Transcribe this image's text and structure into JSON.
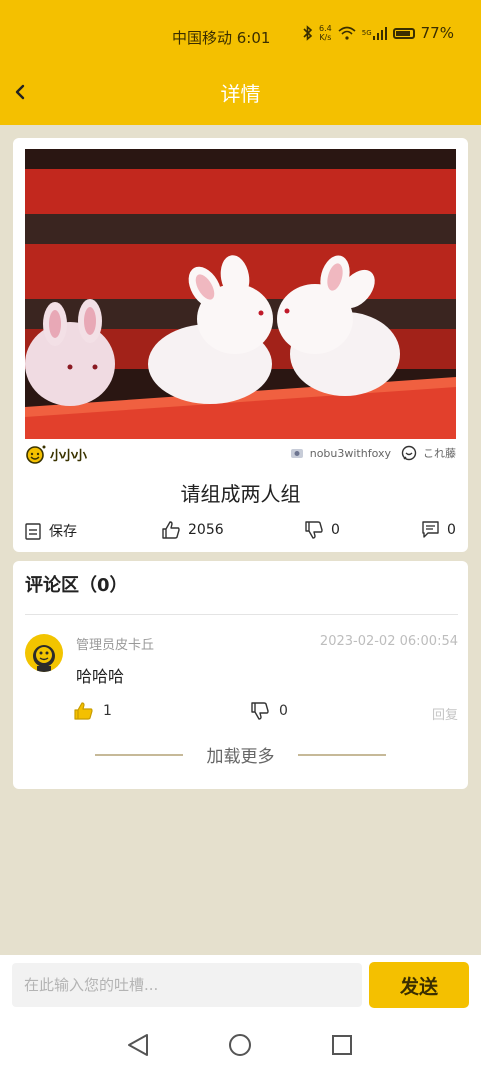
{
  "status_bar": {
    "carrier_time": "中国移动 6:01",
    "net_speed_top": "6.4",
    "net_speed_bottom": "K/s",
    "signal_label": "5G",
    "battery": "77%"
  },
  "header": {
    "title": "详情"
  },
  "post": {
    "credit_left": "小小小",
    "photographer": "nobu3withfoxy",
    "source": "これ藤",
    "title": "请组成两人组",
    "save_label": "保存",
    "like_count": "2056",
    "dislike_count": "0",
    "comment_count": "0"
  },
  "comments_section": {
    "title": "评论区（0）",
    "comments": [
      {
        "author": "管理员皮卡丘",
        "time": "2023-02-02 06:00:54",
        "text": "哈哈哈",
        "likes": "1",
        "dislikes": "0",
        "reply_label": "回复"
      }
    ],
    "load_more_label": "加载更多"
  },
  "composer": {
    "placeholder": "在此输入您的吐槽...",
    "send_label": "发送"
  },
  "colors": {
    "accent": "#f4c000",
    "background": "#e5e0cd"
  }
}
